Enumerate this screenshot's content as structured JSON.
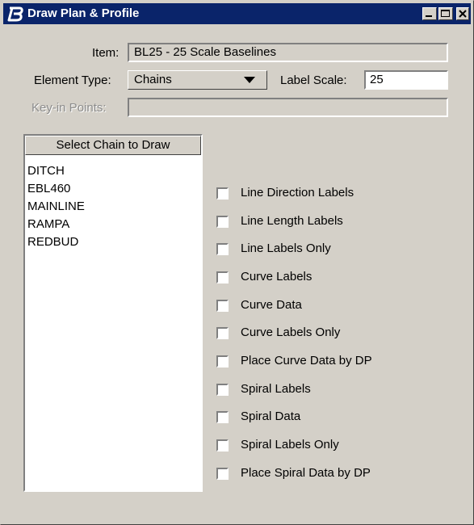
{
  "window": {
    "title": "Draw Plan & Profile",
    "controls": [
      "minimize-icon",
      "maximize-icon",
      "close-icon"
    ]
  },
  "form": {
    "item_label": "Item:",
    "item_value": "BL25 - 25 Scale Baselines",
    "element_type_label": "Element Type:",
    "element_type_value": "Chains",
    "label_scale_label": "Label Scale:",
    "label_scale_value": "25",
    "keyin_points_label": "Key-in Points:",
    "keyin_points_value": ""
  },
  "chain_list": {
    "header": "Select Chain to Draw",
    "items": [
      "DITCH",
      "EBL460",
      "MAINLINE",
      "RAMPA",
      "REDBUD"
    ]
  },
  "options": [
    {
      "label": "Line Direction Labels",
      "checked": false
    },
    {
      "label": "Line Length Labels",
      "checked": false
    },
    {
      "label": "Line Labels Only",
      "checked": false
    },
    {
      "label": "Curve Labels",
      "checked": false
    },
    {
      "label": "Curve Data",
      "checked": false
    },
    {
      "label": "Curve Labels Only",
      "checked": false
    },
    {
      "label": "Place Curve Data by DP",
      "checked": false
    },
    {
      "label": "Spiral Labels",
      "checked": false
    },
    {
      "label": "Spiral Data",
      "checked": false
    },
    {
      "label": "Spiral Labels Only",
      "checked": false
    },
    {
      "label": "Place Spiral Data by DP",
      "checked": false
    }
  ],
  "colors": {
    "title_bar": "#0a246a",
    "dialog_face": "#d4d0c8",
    "disabled_text": "#8c8c8c"
  }
}
